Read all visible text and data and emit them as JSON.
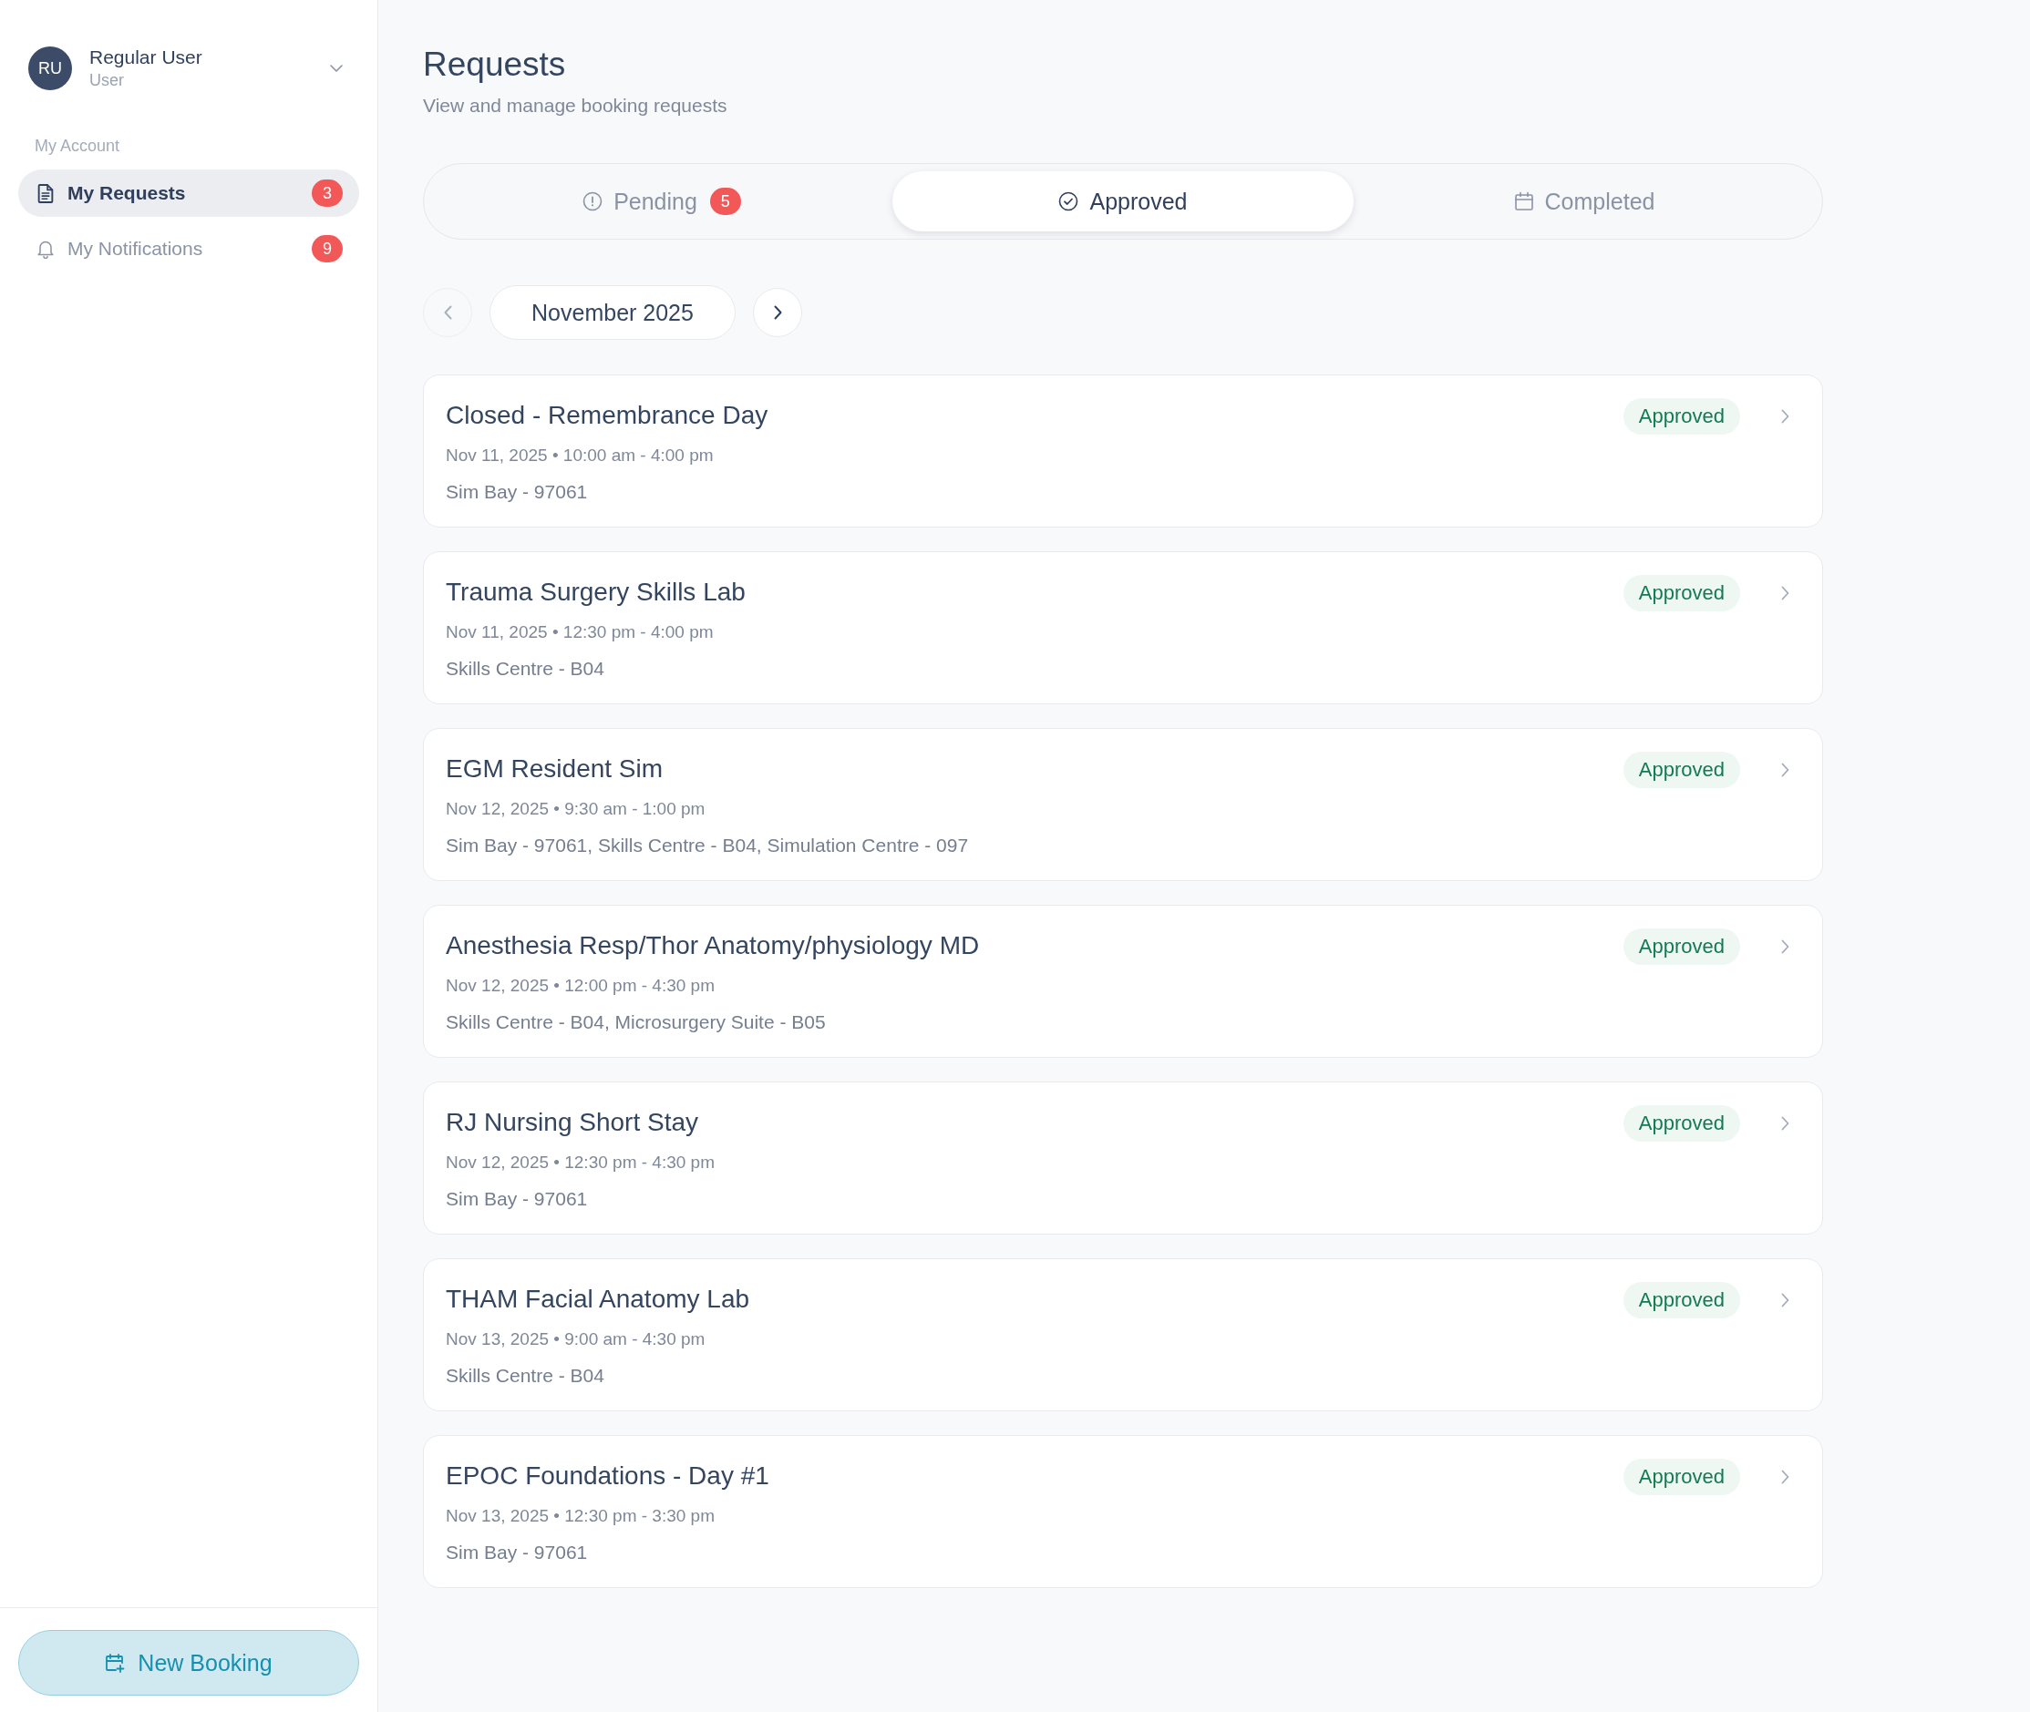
{
  "sidebar": {
    "user": {
      "initials": "RU",
      "name": "Regular User",
      "role": "User"
    },
    "section_label": "My Account",
    "items": [
      {
        "label": "My Requests",
        "badge": "3",
        "selected": true
      },
      {
        "label": "My Notifications",
        "badge": "9",
        "selected": false
      }
    ],
    "new_booking_button": "New Booking"
  },
  "page": {
    "title": "Requests",
    "subtitle": "View and manage booking requests"
  },
  "tabs": [
    {
      "label": "Pending",
      "badge": "5",
      "selected": false
    },
    {
      "label": "Approved",
      "selected": true
    },
    {
      "label": "Completed",
      "selected": false
    }
  ],
  "month_nav": {
    "label": "November 2025",
    "prev": {
      "disabled": true
    },
    "next": {
      "disabled": false
    }
  },
  "requests": [
    {
      "title": "Closed - Remembrance Day",
      "datetime": "Nov 11, 2025 • 10:00 am - 4:00 pm",
      "location": "Sim Bay - 97061",
      "status": "Approved"
    },
    {
      "title": "Trauma Surgery Skills Lab",
      "datetime": "Nov 11, 2025 • 12:30 pm - 4:00 pm",
      "location": "Skills Centre - B04",
      "status": "Approved"
    },
    {
      "title": "EGM Resident Sim",
      "datetime": "Nov 12, 2025 • 9:30 am - 1:00 pm",
      "location": "Sim Bay - 97061, Skills Centre - B04, Simulation Centre - 097",
      "status": "Approved"
    },
    {
      "title": "Anesthesia Resp/Thor Anatomy/physiology MD",
      "datetime": "Nov 12, 2025 • 12:00 pm - 4:30 pm",
      "location": "Skills Centre - B04, Microsurgery Suite - B05",
      "status": "Approved"
    },
    {
      "title": "RJ Nursing Short Stay",
      "datetime": "Nov 12, 2025 • 12:30 pm - 4:30 pm",
      "location": "Sim Bay - 97061",
      "status": "Approved"
    },
    {
      "title": "THAM Facial Anatomy Lab",
      "datetime": "Nov 13, 2025 • 9:00 am - 4:30 pm",
      "location": "Skills Centre - B04",
      "status": "Approved"
    },
    {
      "title": "EPOC Foundations - Day #1",
      "datetime": "Nov 13, 2025 • 12:30 pm - 3:30 pm",
      "location": "Sim Bay - 97061",
      "status": "Approved"
    }
  ]
}
